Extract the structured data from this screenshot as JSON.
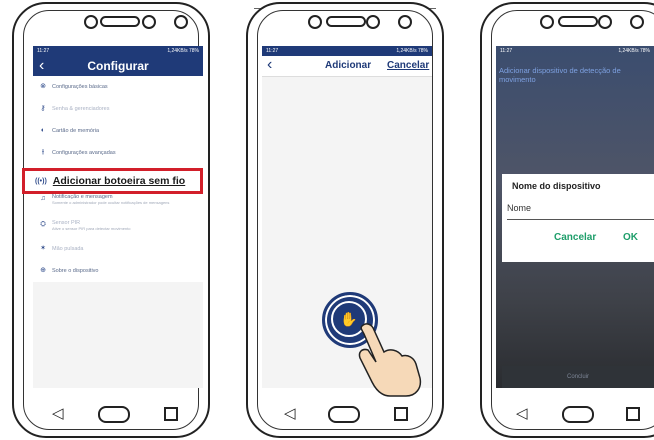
{
  "screen1": {
    "status_time": "11:27",
    "status_right": "1,24KB/s  78%",
    "back_glyph": "‹",
    "title": "Configurar",
    "menu": [
      {
        "label": "Configurações básicas",
        "icon": "settings-icon"
      },
      {
        "label": "Senha & gerenciadores",
        "icon": "key-icon"
      },
      {
        "label": "Cartão de memória",
        "icon": "sd-card-icon"
      },
      {
        "label": "Configurações avançadas",
        "icon": "sliders-icon"
      },
      {
        "label": "Adicionar botoeira sem fio",
        "icon": "wireless-icon"
      },
      {
        "label": "Notificação e mensagem",
        "sub": "Somente o administrador pode ocultar notificações de mensagens",
        "icon": "bell-icon"
      },
      {
        "label": "Sensor PIR",
        "sub": "Ative o sensor PIR para detectar movimento",
        "icon": "motion-icon"
      },
      {
        "label": "Mão pulsada",
        "icon": "hand-icon"
      },
      {
        "label": "Sobre o dispositivo",
        "icon": "info-icon"
      }
    ]
  },
  "screen2": {
    "status_time": "11:27",
    "status_right": "1,24KB/s  78%",
    "back_glyph": "‹",
    "title": "Adicionar",
    "cancel": "Cancelar",
    "pair_glyph": "✋"
  },
  "screen3": {
    "status_time": "11:27",
    "status_right": "1,24KB/s  78%",
    "heading": "Adicionar dispositivo de detecção de movimento",
    "dialog_title": "Nome do dispositivo",
    "dialog_input": "Nome",
    "cancel": "Cancelar",
    "ok": "OK",
    "bottom_button": "Concluir"
  },
  "colors": {
    "header": "#1f3a78",
    "highlight": "#d21f2a",
    "dialog_action": "#1e9e6a"
  }
}
